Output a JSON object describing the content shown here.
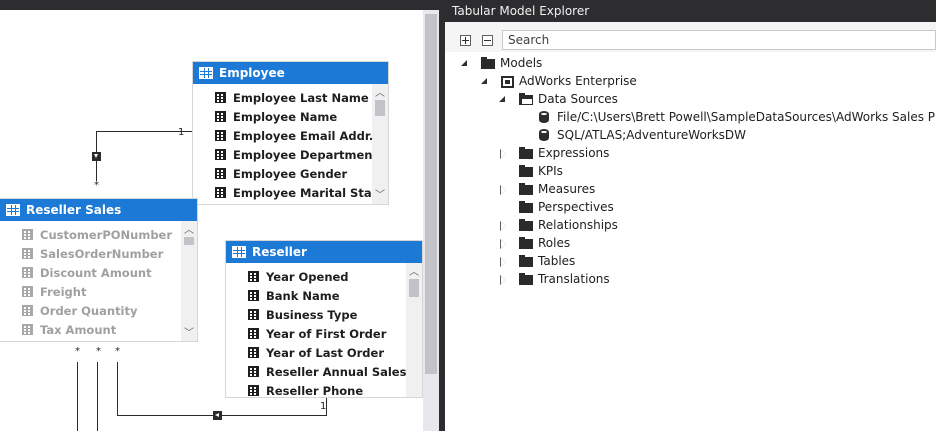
{
  "explorer": {
    "title": "Tabular Model Explorer",
    "expand_all_label": "Expand all",
    "collapse_all_label": "Collapse all",
    "search_placeholder": "Search",
    "tree": {
      "models": "Models",
      "model": "AdWorks Enterprise",
      "data_sources": "Data Sources",
      "ds1": "File/C:\\Users\\Brett Powell\\SampleDataSources\\AdWorks Sales Plan xlsx",
      "ds2": "SQL/ATLAS;AdventureWorksDW",
      "expressions": "Expressions",
      "kpis": "KPIs",
      "measures": "Measures",
      "perspectives": "Perspectives",
      "relationships": "Relationships",
      "roles": "Roles",
      "tables": "Tables",
      "translations": "Translations"
    }
  },
  "diagram": {
    "employee": {
      "title": "Employee",
      "columns": [
        "Employee Last Name",
        "Employee Name",
        "Employee Email Addr...",
        "Employee Department",
        "Employee Gender",
        "Employee Marital Sta..."
      ]
    },
    "reseller_sales": {
      "title": "Reseller Sales",
      "columns": [
        "CustomerPONumber",
        "SalesOrderNumber",
        "Discount Amount",
        "Freight",
        "Order Quantity",
        "Tax Amount"
      ]
    },
    "reseller": {
      "title": "Reseller",
      "columns": [
        "Year Opened",
        "Bank Name",
        "Business Type",
        "Year of First Order",
        "Year of Last Order",
        "Reseller Annual Sales",
        "Reseller Phone"
      ]
    },
    "rel_labels": {
      "one": "1",
      "many": "*"
    }
  },
  "colors": {
    "header_blue": "#1c7ad6",
    "panel_dark": "#2d2d30"
  }
}
